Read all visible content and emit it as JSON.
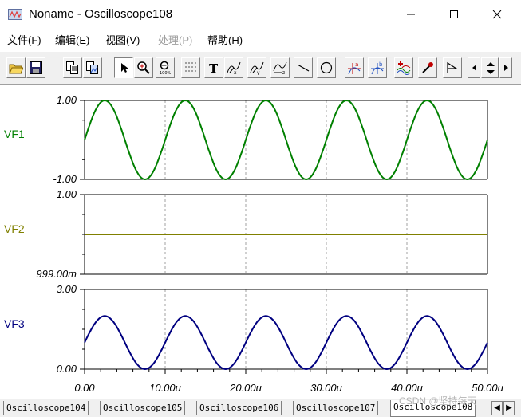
{
  "window": {
    "title": "Noname - Oscilloscope108",
    "app_icon": "oscilloscope-app-icon",
    "minimize_icon": "minimize-icon",
    "maximize_icon": "maximize-icon",
    "close_icon": "close-icon"
  },
  "menu": [
    {
      "label": "文件(F)",
      "enabled": true
    },
    {
      "label": "编辑(E)",
      "enabled": true
    },
    {
      "label": "视图(V)",
      "enabled": true
    },
    {
      "label": "处理(P)",
      "enabled": false
    },
    {
      "label": "帮助(H)",
      "enabled": true
    }
  ],
  "toolbar": {
    "buttons": [
      {
        "name": "open-icon",
        "pressed": false
      },
      {
        "name": "save-icon",
        "pressed": false
      },
      {
        "name": "copy-icon",
        "pressed": false
      },
      {
        "name": "copy-image-icon",
        "pressed": false
      },
      {
        "name": "pointer-icon",
        "pressed": true
      },
      {
        "name": "zoom-in-icon",
        "pressed": false
      },
      {
        "name": "zoom-100-icon",
        "pressed": false
      },
      {
        "name": "grid-icon",
        "pressed": false
      },
      {
        "name": "text-icon",
        "pressed": false
      },
      {
        "name": "label-x-icon",
        "pressed": false
      },
      {
        "name": "label-y-icon",
        "pressed": false
      },
      {
        "name": "label-z-icon",
        "pressed": false
      },
      {
        "name": "line-icon",
        "pressed": false
      },
      {
        "name": "circle-icon",
        "pressed": false
      },
      {
        "name": "cursor-a-icon",
        "pressed": false
      },
      {
        "name": "cursor-b-icon",
        "pressed": false
      },
      {
        "name": "add-trace-icon",
        "pressed": false
      },
      {
        "name": "probe-icon",
        "pressed": false
      },
      {
        "name": "flag-icon",
        "pressed": false
      },
      {
        "name": "scroll-left-icon",
        "pressed": false
      },
      {
        "name": "scroll-updown-icon",
        "pressed": false
      },
      {
        "name": "scroll-right-icon",
        "pressed": false
      }
    ]
  },
  "colors": {
    "vf1": "#008000",
    "vf2": "#808000",
    "vf3": "#000080",
    "frame": "#000000",
    "grid": "#a0a0a0"
  },
  "chart_data": [
    {
      "type": "line",
      "ylabel": "VF1",
      "ylim": [
        -1.0,
        1.0
      ],
      "ytick_labels": [
        "1.00",
        "-1.00"
      ],
      "series": [
        {
          "name": "VF1",
          "function": "sine",
          "amplitude": 1.0,
          "offset": 0.0,
          "period_us": 10.0,
          "phase_deg": 0
        }
      ],
      "x_range_us": [
        0,
        50
      ]
    },
    {
      "type": "line",
      "ylabel": "VF2",
      "ylim": [
        0.999,
        1.0
      ],
      "ytick_labels": [
        "1.00",
        "999.00m"
      ],
      "series": [
        {
          "name": "VF2",
          "function": "constant",
          "value": 0.9995
        }
      ],
      "x_range_us": [
        0,
        50
      ]
    },
    {
      "type": "line",
      "ylabel": "VF3",
      "ylim": [
        0.0,
        3.0
      ],
      "ytick_labels": [
        "3.00",
        "0.00"
      ],
      "series": [
        {
          "name": "VF3",
          "function": "sine",
          "amplitude": 1.0,
          "offset": 1.0,
          "period_us": 10.0,
          "phase_deg": 0
        }
      ],
      "x_range_us": [
        0,
        50
      ],
      "xtick_labels": [
        "0.00",
        "10.00u",
        "20.00u",
        "30.00u",
        "40.00u",
        "50.00u"
      ]
    }
  ],
  "tabs": [
    {
      "label": "Oscilloscope104",
      "active": false
    },
    {
      "label": "Oscilloscope105",
      "active": false
    },
    {
      "label": "Oscilloscope106",
      "active": false
    },
    {
      "label": "Oscilloscope107",
      "active": false
    },
    {
      "label": "Oscilloscope108",
      "active": true
    }
  ],
  "watermark": "CSDN @坚持每天"
}
